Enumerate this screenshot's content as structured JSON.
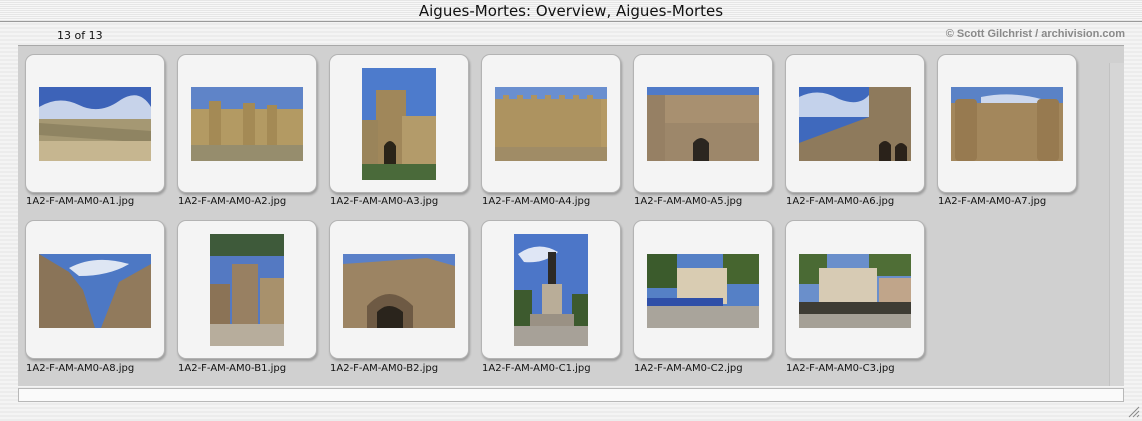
{
  "window": {
    "title": "Aigues-Mortes: Overview, Aigues-Mortes"
  },
  "header": {
    "counter": "13 of 13",
    "credit": "© Scott Gilchrist / archivision.com"
  },
  "thumbnails": [
    {
      "filename": "1A2-F-AM-AM0-A1.jpg",
      "subject": "low city rampart wall under blue sky"
    },
    {
      "filename": "1A2-F-AM-AM0-A2.jpg",
      "subject": "ramparts with towers"
    },
    {
      "filename": "1A2-F-AM-AM0-A3.jpg",
      "subject": "tall gate tower"
    },
    {
      "filename": "1A2-F-AM-AM0-A4.jpg",
      "subject": "crenellated wall"
    },
    {
      "filename": "1A2-F-AM-AM0-A5.jpg",
      "subject": "wall with gateway"
    },
    {
      "filename": "1A2-F-AM-AM0-A6.jpg",
      "subject": "wall corner with arches"
    },
    {
      "filename": "1A2-F-AM-AM0-A7.jpg",
      "subject": "wall with round towers"
    },
    {
      "filename": "1A2-F-AM-AM0-A8.jpg",
      "subject": "looking up at towers"
    },
    {
      "filename": "1A2-F-AM-AM0-B1.jpg",
      "subject": "street with church"
    },
    {
      "filename": "1A2-F-AM-AM0-B2.jpg",
      "subject": "arched wall detail"
    },
    {
      "filename": "1A2-F-AM-AM0-C1.jpg",
      "subject": "statue and fountain"
    },
    {
      "filename": "1A2-F-AM-AM0-C2.jpg",
      "subject": "town square cafe"
    },
    {
      "filename": "1A2-F-AM-AM0-C3.jpg",
      "subject": "square with plane trees"
    }
  ]
}
